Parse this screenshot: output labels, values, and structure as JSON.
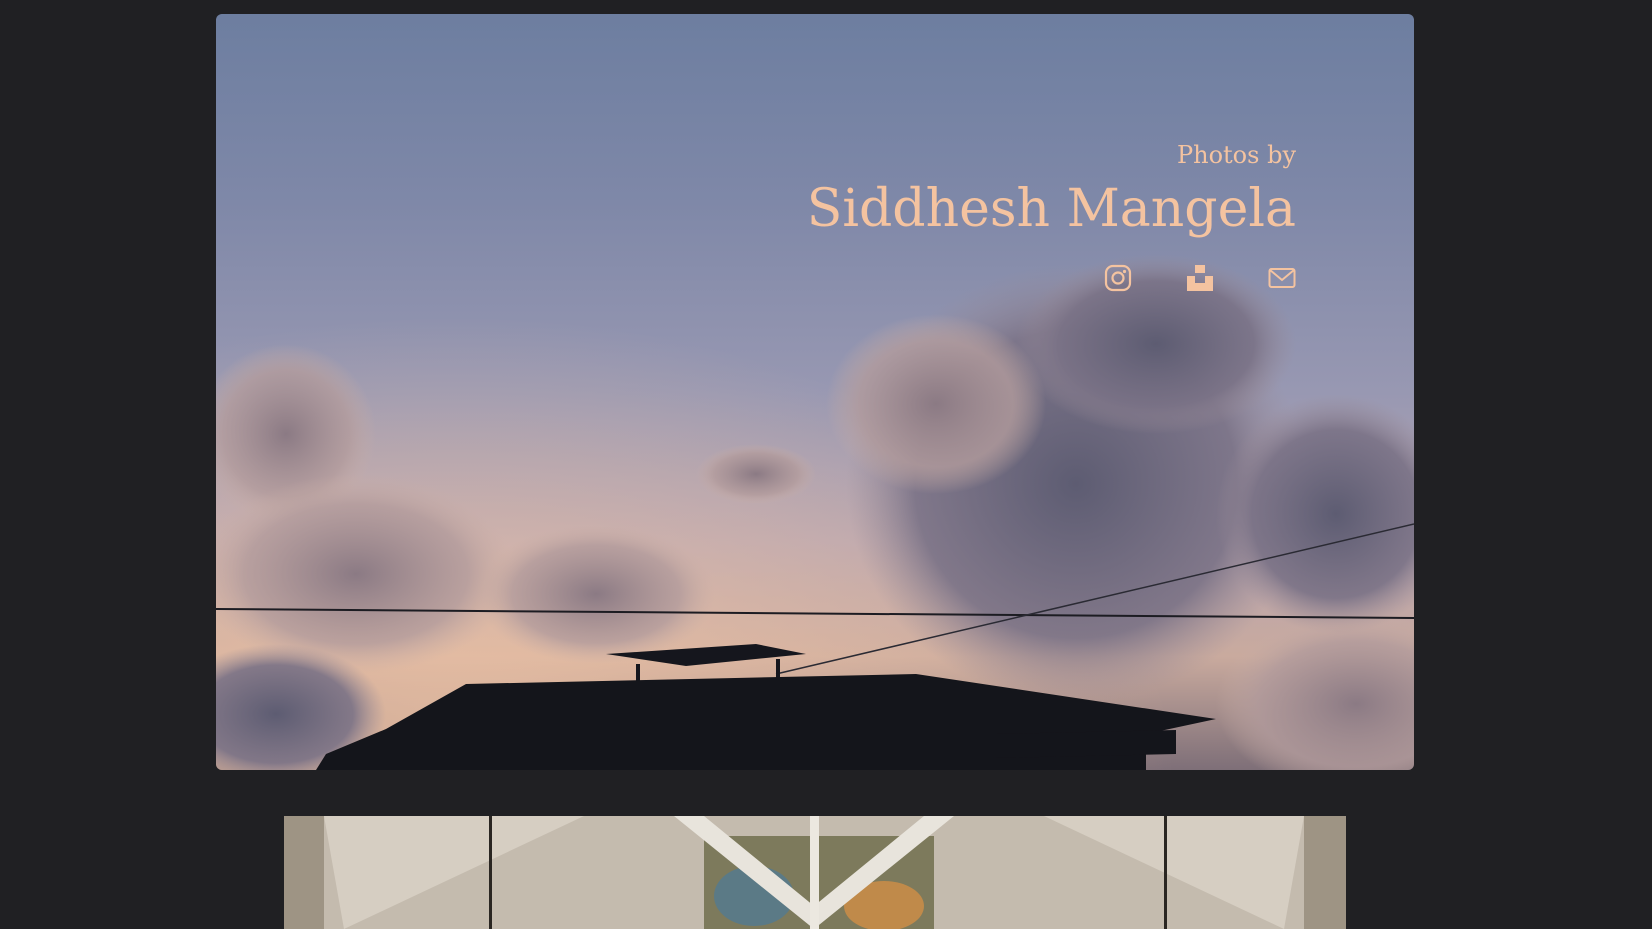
{
  "hero": {
    "subtitle": "Photos by",
    "name": "Siddhesh Mangela"
  },
  "socials": [
    {
      "icon": "instagram-icon"
    },
    {
      "icon": "unsplash-icon"
    },
    {
      "icon": "mail-icon"
    }
  ],
  "colors": {
    "background": "#202023",
    "accent": "#f4c3a0"
  }
}
